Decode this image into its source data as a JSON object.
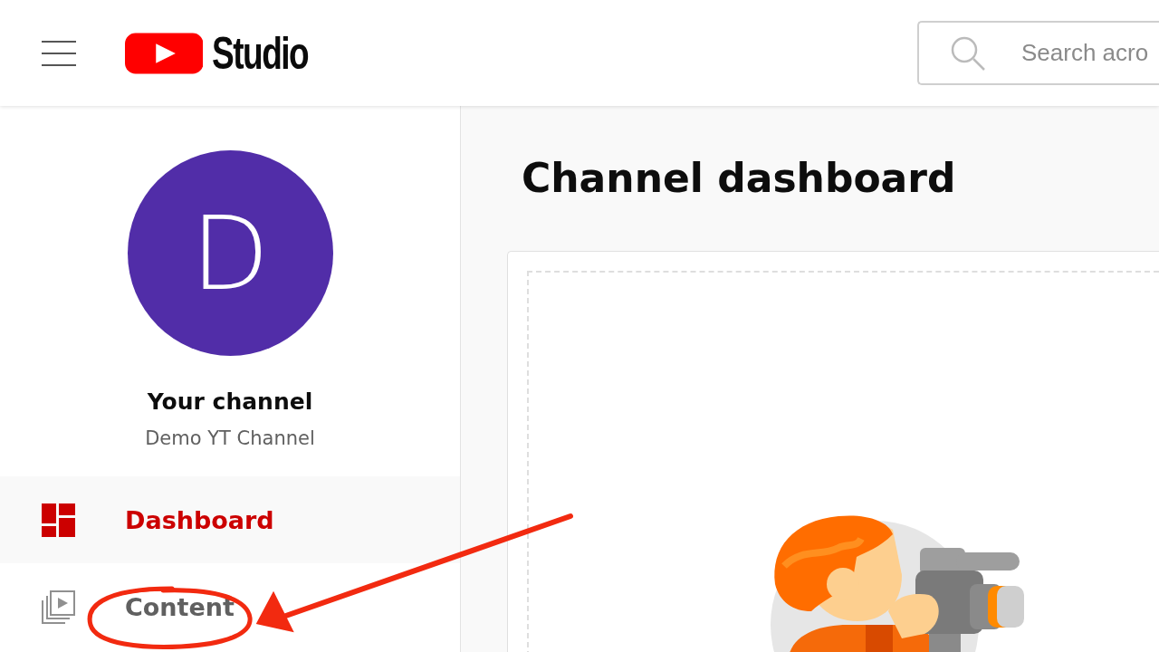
{
  "header": {
    "logo_text": "Studio",
    "search": {
      "placeholder": "Search acro"
    }
  },
  "sidebar": {
    "avatar_letter": "D",
    "channel_title": "Your channel",
    "channel_name": "Demo YT Channel",
    "items": [
      {
        "label": "Dashboard",
        "kind": "dashboard",
        "selected": true
      },
      {
        "label": "Content",
        "kind": "content",
        "selected": false
      }
    ]
  },
  "main": {
    "title": "Channel dashboard"
  }
}
